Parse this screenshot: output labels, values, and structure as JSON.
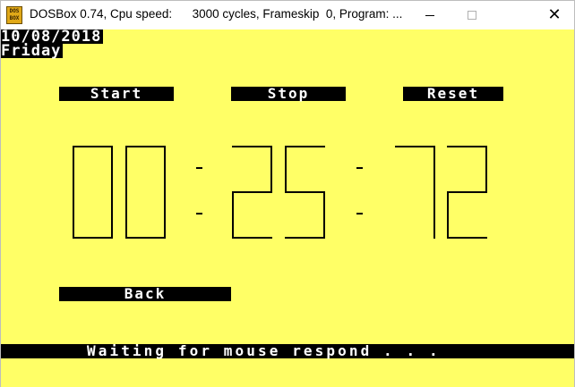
{
  "window": {
    "title": "DOSBox 0.74, Cpu speed:      3000 cycles, Frameskip  0, Program: ...",
    "icon_label_line1": "DOS",
    "icon_label_line2": "BOX",
    "icon": "dosbox-icon",
    "minimize_icon": "minimize-icon",
    "maximize_icon": "maximize-icon",
    "close_icon": "close-icon",
    "close_glyph": "✕"
  },
  "screen": {
    "background": "#ffff66",
    "date": "10/08/2018",
    "day": "Friday",
    "buttons": {
      "start": "Start",
      "stop": "Stop",
      "reset": "Reset",
      "back": "Back"
    },
    "timer": {
      "hours": "00",
      "minutes": "25",
      "seconds": "72",
      "separator": ":"
    },
    "status": "Waiting for mouse respond . . ."
  }
}
